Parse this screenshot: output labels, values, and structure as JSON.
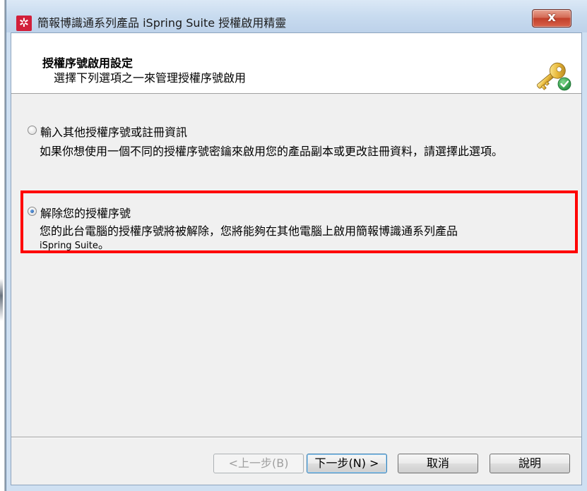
{
  "window": {
    "title": "簡報博識通系列產品 iSpring Suite 授權啟用精靈",
    "close_glyph": "x"
  },
  "header": {
    "title": "授權序號啟用設定",
    "subtitle": "選擇下列選項之一來管理授權序號啟用",
    "icon": "key-check-icon"
  },
  "options": [
    {
      "label": "輸入其他授權序號或註冊資訊",
      "description": "如果你想使用一個不同的授權序號密鑰來啟用您的產品副本或更改註冊資料，請選擇此選項。",
      "selected": false
    },
    {
      "label": "解除您的授權序號",
      "description_line1": "您的此台電腦的授權序號將被解除，您將能夠在其他電腦上啟用簡報博識通系列產品",
      "description_latin": "iSpring Suite",
      "description_end": "。",
      "selected": true
    }
  ],
  "buttons": {
    "back": "<上一步(B)",
    "next": "下一步(N) >",
    "cancel": "取消",
    "help": "說明"
  },
  "colors": {
    "highlight_box": "#ff0000",
    "titlebar": "#c8dbef",
    "close_button": "#c2402b"
  }
}
